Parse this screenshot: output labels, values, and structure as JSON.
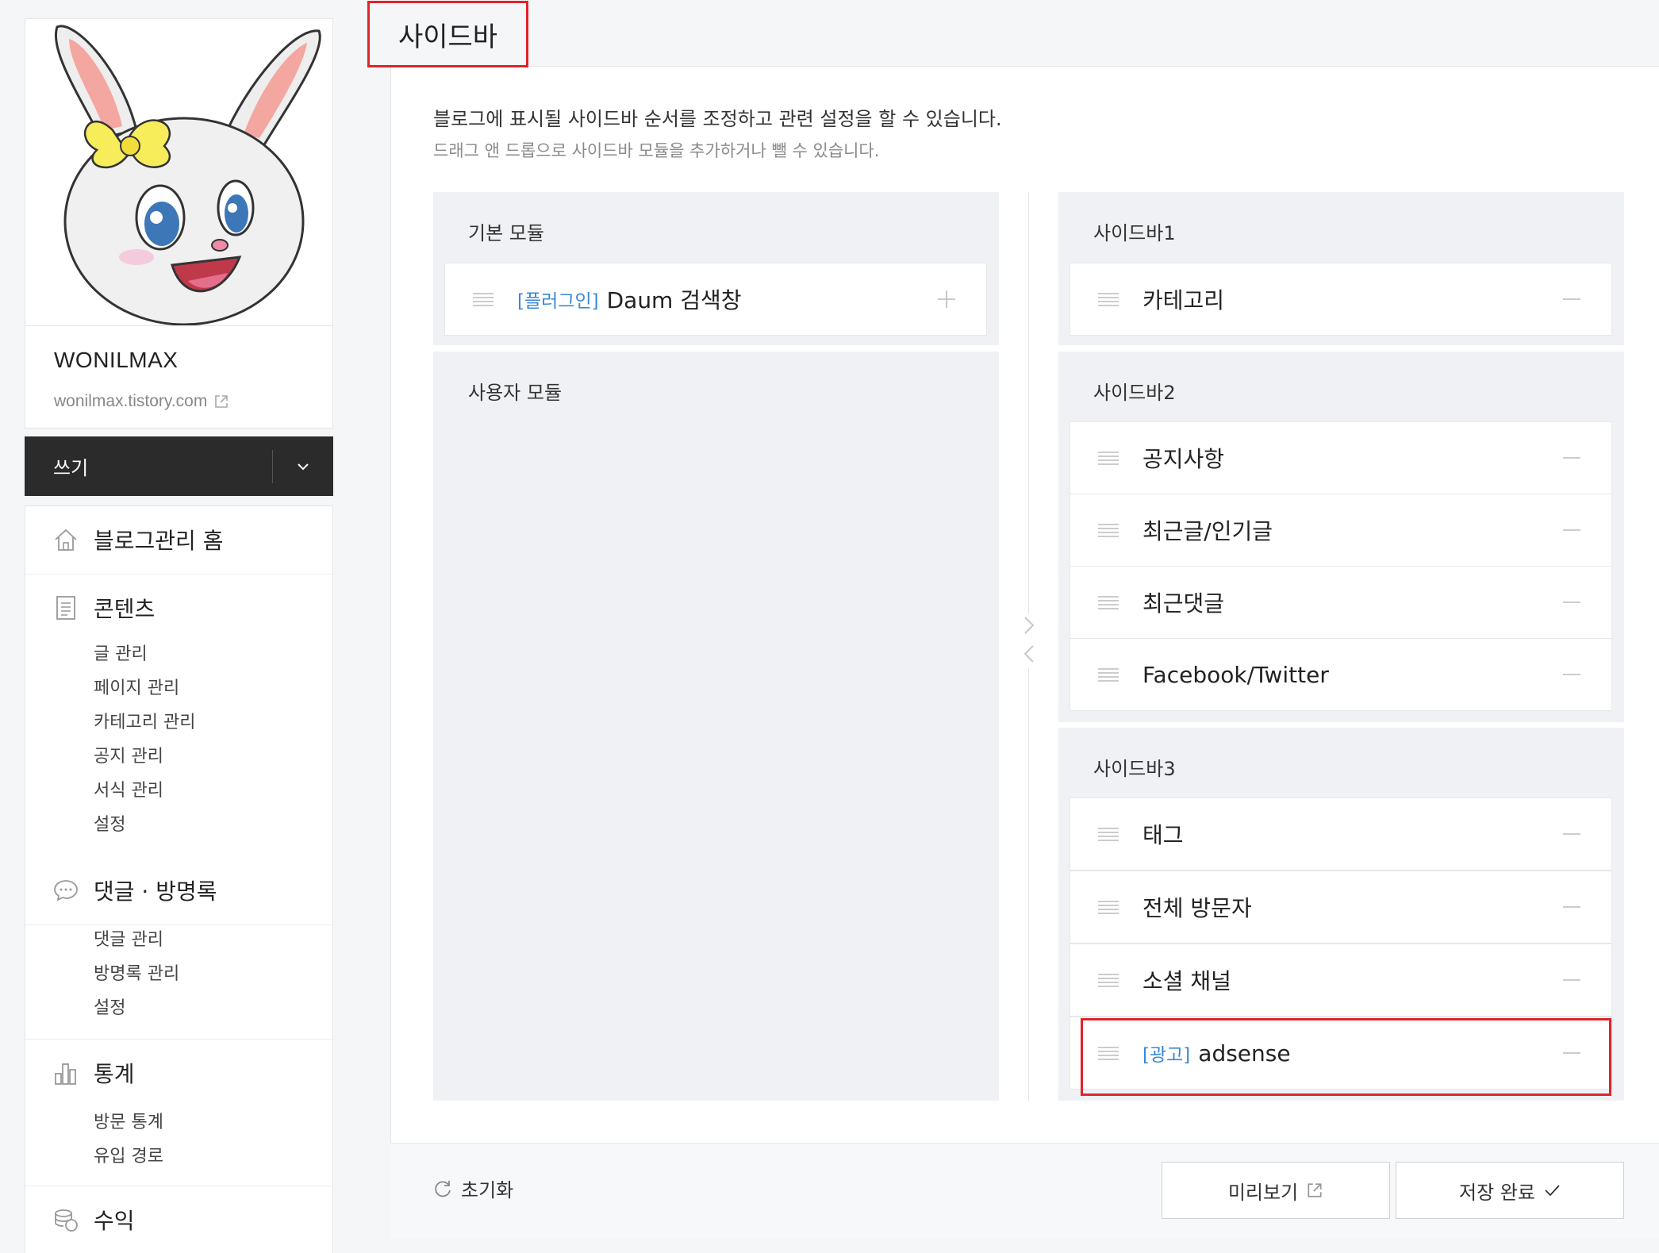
{
  "profile": {
    "blog_name": "WONILMAX",
    "blog_url": "wonilmax.tistory.com"
  },
  "write": {
    "label": "쓰기"
  },
  "menu": {
    "home": "블로그관리 홈",
    "contents": {
      "title": "콘텐츠",
      "items": [
        "글 관리",
        "페이지 관리",
        "카테고리 관리",
        "공지 관리",
        "서식 관리",
        "설정"
      ]
    },
    "comments": {
      "title": "댓글 · 방명록",
      "items": [
        "댓글 관리",
        "방명록 관리",
        "설정"
      ]
    },
    "stats": {
      "title": "통계",
      "items": [
        "방문 통계",
        "유입 경로"
      ]
    },
    "revenue": {
      "title": "수익"
    }
  },
  "page": {
    "title": "사이드바",
    "description": "블로그에 표시될 사이드바 순서를 조정하고 관련 설정을 할 수 있습니다.",
    "hint": "드래그 앤 드롭으로 사이드바 모듈을 추가하거나 뺄 수 있습니다."
  },
  "available": {
    "basic": {
      "title": "기본 모듈",
      "modules": [
        {
          "tag": "[플러그인]",
          "label": "Daum 검색창"
        }
      ]
    },
    "user": {
      "title": "사용자 모듈"
    }
  },
  "sidebars": [
    {
      "title": "사이드바1",
      "modules": [
        {
          "tag": "",
          "label": "카테고리"
        }
      ]
    },
    {
      "title": "사이드바2",
      "modules": [
        {
          "tag": "",
          "label": "공지사항"
        },
        {
          "tag": "",
          "label": "최근글/인기글"
        },
        {
          "tag": "",
          "label": "최근댓글"
        },
        {
          "tag": "",
          "label": "Facebook/Twitter"
        }
      ]
    },
    {
      "title": "사이드바3",
      "modules": [
        {
          "tag": "",
          "label": "태그"
        },
        {
          "tag": "",
          "label": "전체 방문자"
        },
        {
          "tag": "",
          "label": "소셜 채널"
        },
        {
          "tag": "[광고]",
          "label": "adsense"
        }
      ]
    }
  ],
  "footer": {
    "reset_label": "초기화",
    "preview_label": "미리보기",
    "save_label": "저장 완료"
  },
  "colors": {
    "accent_red": "#e0242c",
    "tag_blue": "#3a88d6",
    "write_bar": "#2b2b2b"
  }
}
